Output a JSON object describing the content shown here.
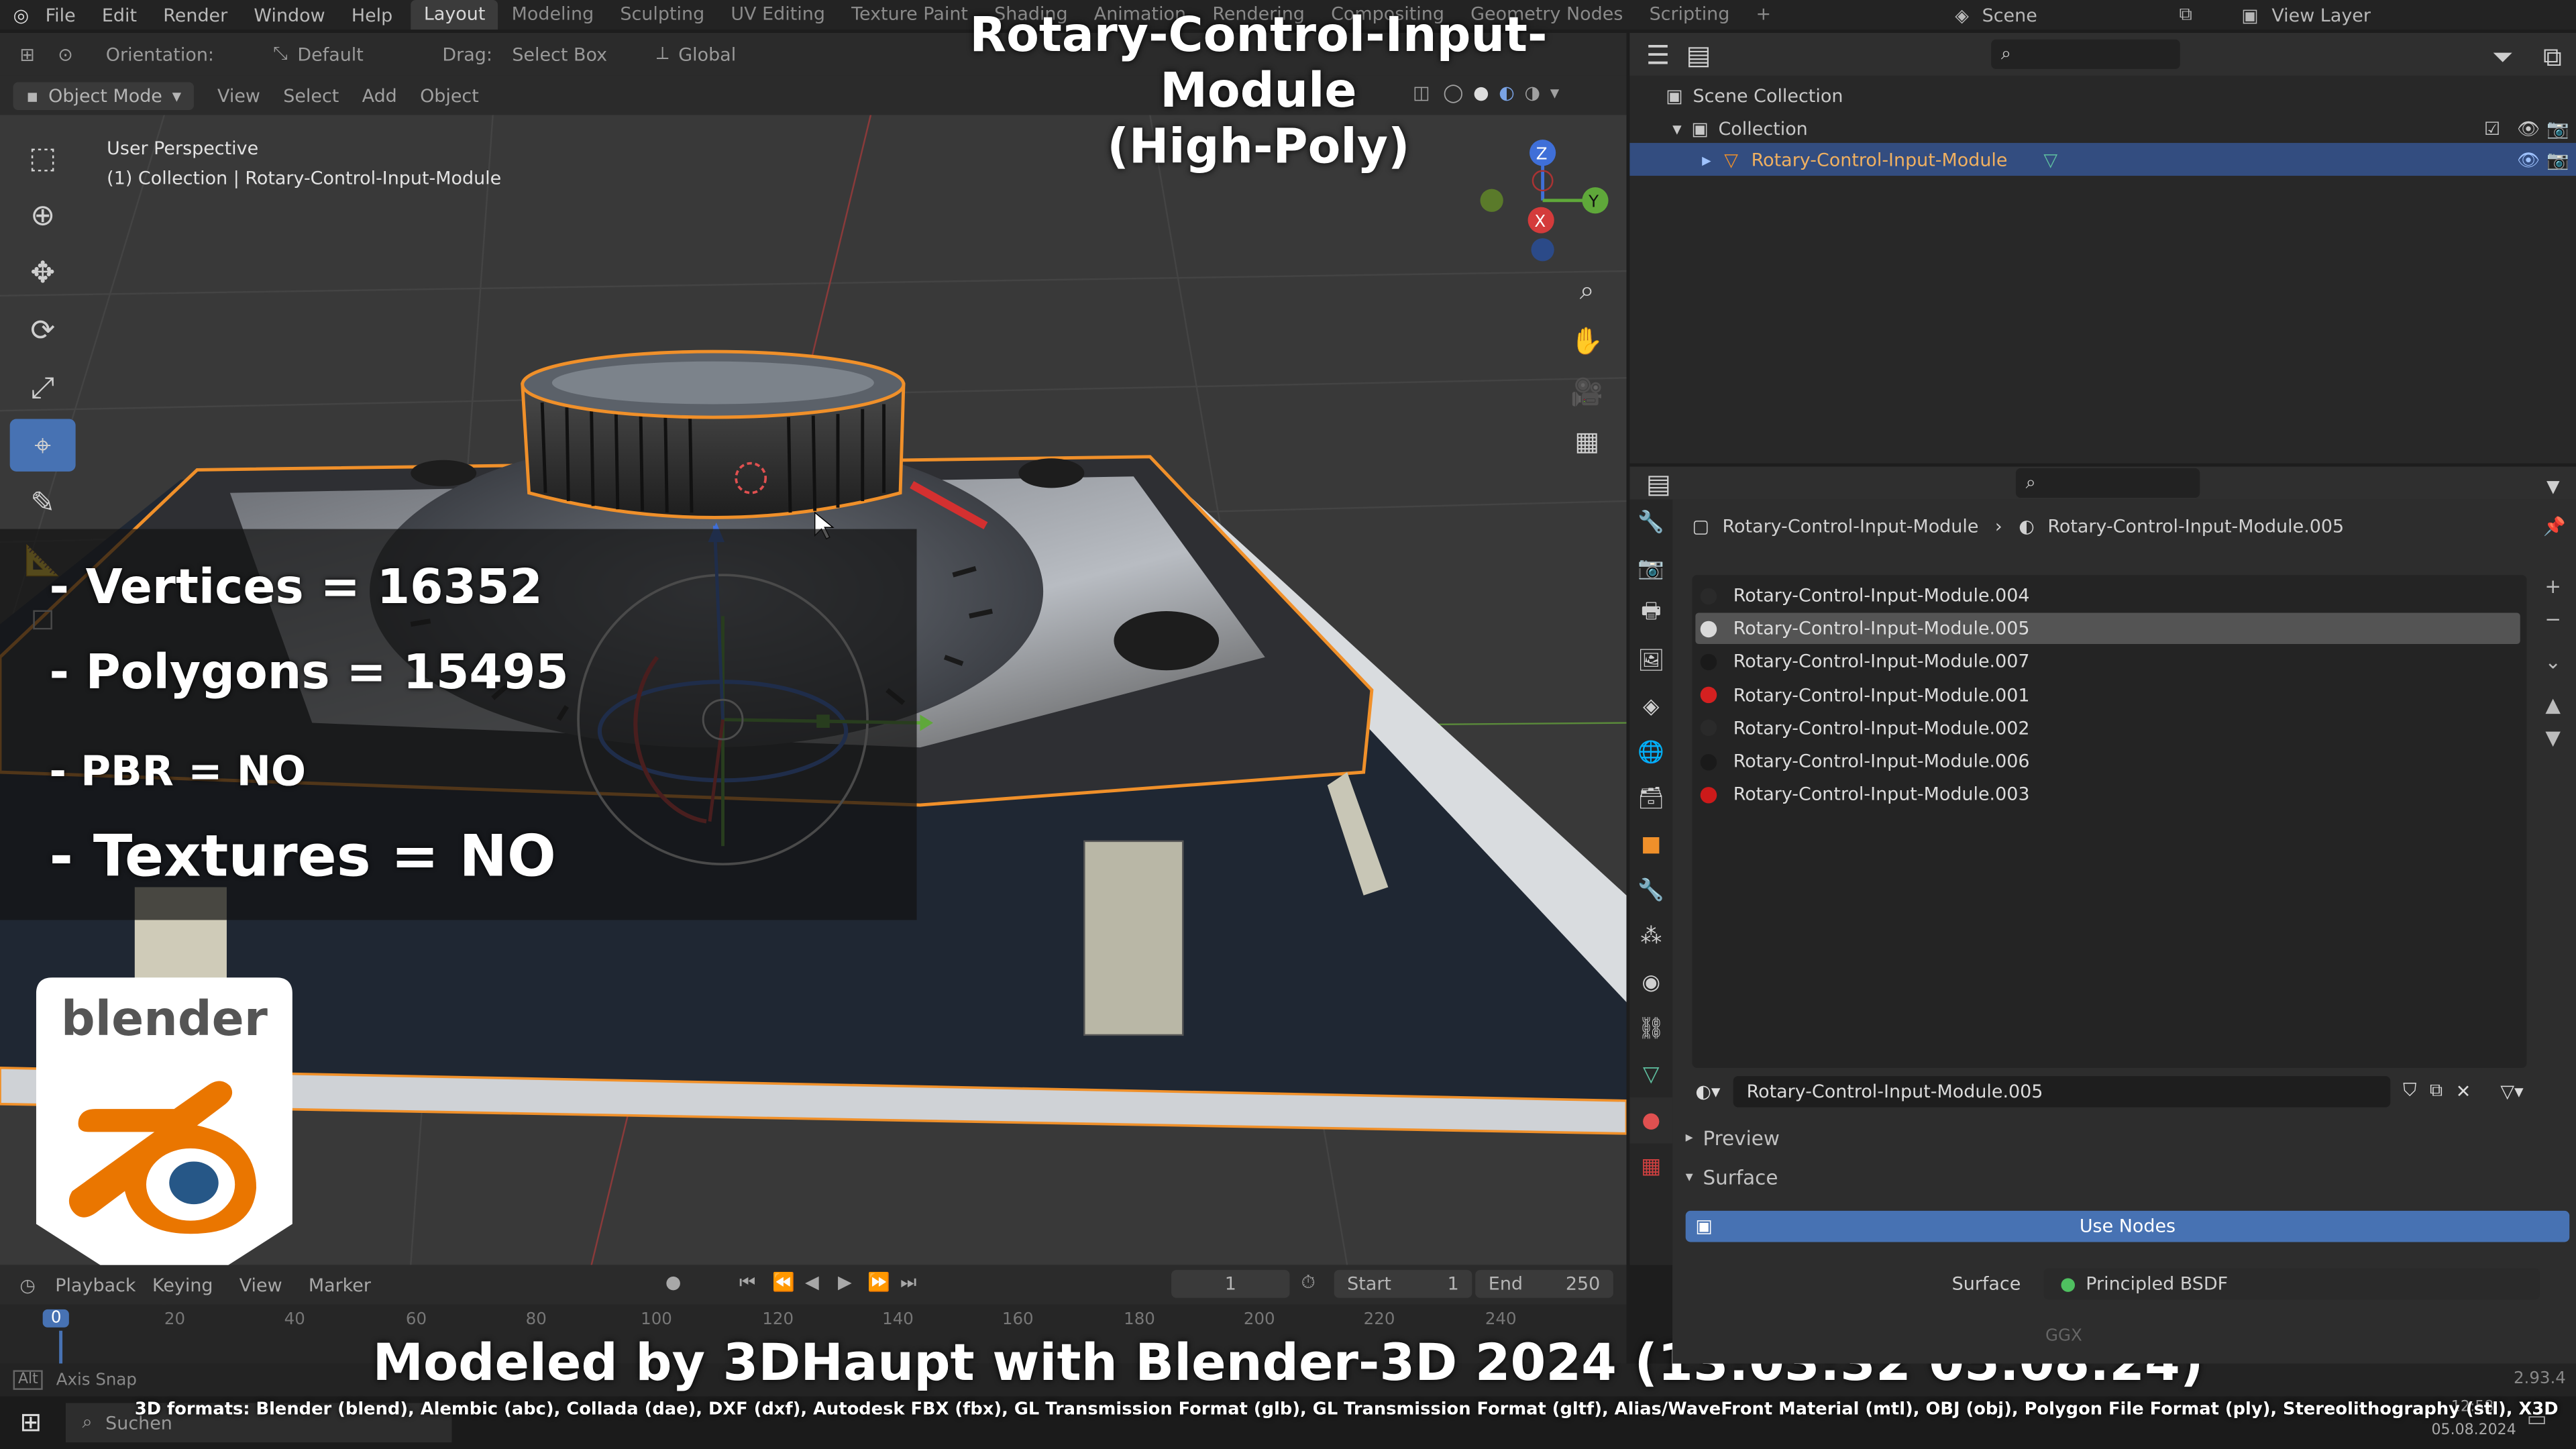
{
  "app": {
    "menu": [
      "File",
      "Edit",
      "Render",
      "Window",
      "Help"
    ],
    "workspaces": [
      "Layout",
      "Modeling",
      "Sculpting",
      "UV Editing",
      "Texture Paint",
      "Shading",
      "Animation",
      "Rendering",
      "Compositing",
      "Geometry Nodes",
      "Scripting"
    ],
    "active_workspace": "Layout",
    "scene_label": "Scene",
    "view_layer_label": "View Layer"
  },
  "header": {
    "orientation_label": "Orientation:",
    "orientation_value": "Default",
    "drag_label": "Drag:",
    "drag_value": "Select Box",
    "transform_value": "Global",
    "mode": "Object Mode",
    "menus": [
      "View",
      "Select",
      "Add",
      "Object"
    ]
  },
  "viewport": {
    "perspective": "User Perspective",
    "collection_path": "(1) Collection | Rotary-Control-Input-Module"
  },
  "overlay": {
    "title_line1": "Rotary-Control-Input-Module",
    "title_line2": "(High-Poly)",
    "vertices": "- Vertices = 16352",
    "polygons": "- Polygons = 15495",
    "pbr": "- PBR =  NO",
    "textures": "- Textures = NO",
    "badge_text": "blender",
    "bottom_title": "Modeled by 3DHaupt with Blender-3D 2024 (13:03:32  05.08.24)",
    "formats": "3D formats: Blender (blend), Alembic (abc), Collada (dae), DXF (dxf), Autodesk FBX (fbx), GL Transmission Format (glb), GL Transmission Format (gltf), Alias/WaveFront Material (mtl), OBJ (obj), Polygon File Format (ply), Stereolithography (stl), X3D"
  },
  "timeline": {
    "menus": [
      "Playback",
      "Keying",
      "View",
      "Marker"
    ],
    "current_frame": "1",
    "start_label": "Start",
    "start_value": "1",
    "end_label": "End",
    "end_value": "250",
    "ticks": [
      "0",
      "20",
      "40",
      "60",
      "80",
      "100",
      "120",
      "140",
      "160",
      "180",
      "200",
      "220",
      "240"
    ],
    "axis_snap": "Axis Snap",
    "search_placeholder": "Suchen"
  },
  "outliner": {
    "scene_collection": "Scene Collection",
    "collection": "Collection",
    "object": "Rotary-Control-Input-Module"
  },
  "properties": {
    "object_name": "Rotary-Control-Input-Module",
    "material_name": "Rotary-Control-Input-Module.005",
    "slots": [
      {
        "name": "Rotary-Control-Input-Module.004",
        "color": "#2a2a2a"
      },
      {
        "name": "Rotary-Control-Input-Module.005",
        "color": "#d9d9d9"
      },
      {
        "name": "Rotary-Control-Input-Module.007",
        "color": "#1a1a1a"
      },
      {
        "name": "Rotary-Control-Input-Module.001",
        "color": "#d42020"
      },
      {
        "name": "Rotary-Control-Input-Module.002",
        "color": "#2a2a2a"
      },
      {
        "name": "Rotary-Control-Input-Module.006",
        "color": "#1a1a1a"
      },
      {
        "name": "Rotary-Control-Input-Module.003",
        "color": "#cc1a1a"
      }
    ],
    "selected_slot_index": 1,
    "preview_label": "Preview",
    "surface_label": "Surface",
    "use_nodes_label": "Use Nodes",
    "surface_field_label": "Surface",
    "surface_shader": "Principled BSDF",
    "ggx_label": "GGX"
  },
  "system": {
    "time": "12:58",
    "date": "05.08.2024",
    "version": "2.93.4"
  },
  "colors": {
    "accent": "#4772b3",
    "selection_orange": "#f0902a",
    "outliner_selected": "#334d80"
  }
}
